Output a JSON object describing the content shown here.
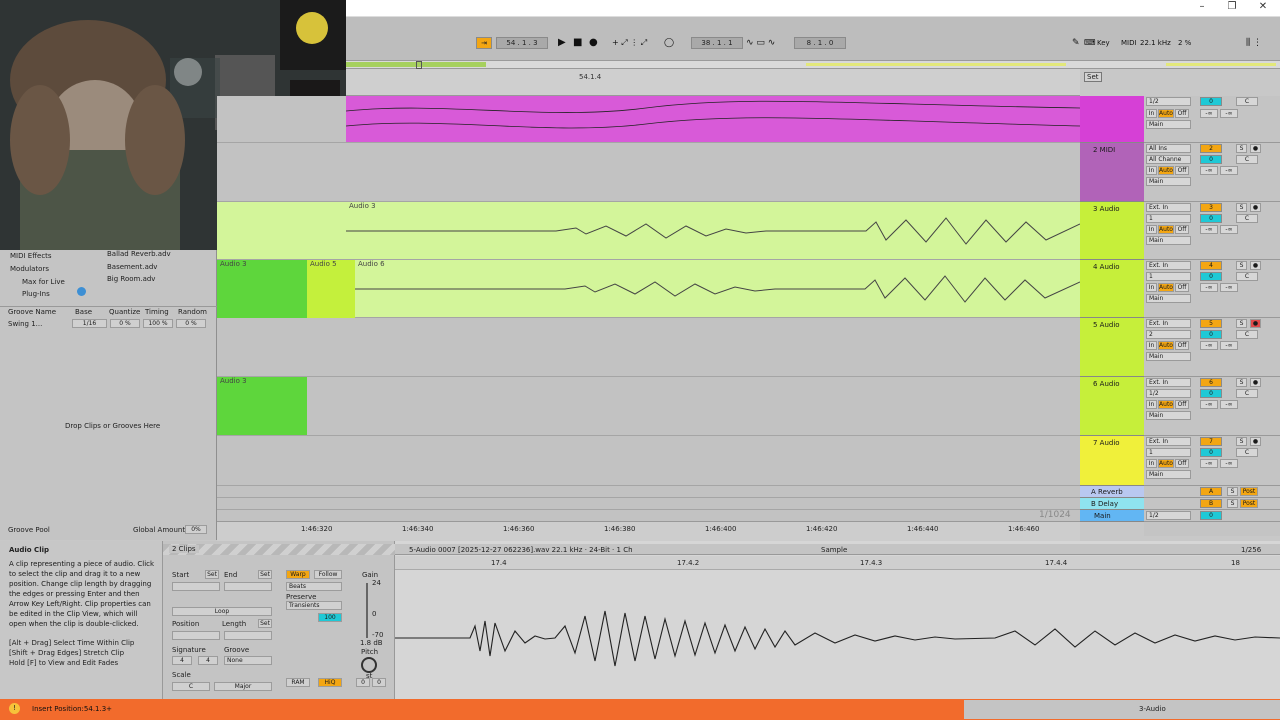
{
  "transport": {
    "tap": "⇥",
    "position": "54 .  1 .  3",
    "loop_start": "38 .  1 .  1",
    "loop_length": "8 .  1 .  0",
    "key": "Key",
    "midi": "MIDI",
    "sample_rate": "22.1 kHz",
    "cpu": "2 %"
  },
  "overview": {
    "marker": "54.1.4"
  },
  "arrangement": {
    "set_label": "Set",
    "pages": "1/1024",
    "drop_clips": "Drop Clips or Grooves Here",
    "clips": [
      {
        "name": "Audio 3"
      },
      {
        "name": "Audio 3"
      },
      {
        "name": "Audio 5"
      },
      {
        "name": "Audio 6"
      },
      {
        "name": "Audio 3"
      }
    ]
  },
  "timeline": [
    "1:46:320",
    "1:46:340",
    "1:46:360",
    "1:46:380",
    "1:46:400",
    "1:46:420",
    "1:46:440",
    "1:46:460"
  ],
  "browser": {
    "categories": [
      "MIDI Effects",
      "Modulators",
      "Max for Live",
      "Plug-Ins"
    ],
    "files": [
      "Ballad Reverb.adv",
      "Basement.adv",
      "Big Room.adv"
    ],
    "groove_headers": [
      "Groove Name",
      "Base",
      "Quantize",
      "Timing",
      "Random"
    ],
    "groove_row": {
      "name": "Swing 1...",
      "base": "1/16",
      "quantize": "0 %",
      "timing": "100 %",
      "random": "0 %"
    },
    "groove_pool": "Groove Pool",
    "global_amount_label": "Global Amount:",
    "global_amount": "0%"
  },
  "tracks": [
    {
      "name": "",
      "input": "1/2",
      "num": "",
      "vol": "0",
      "pan": "C",
      "out": "Main",
      "color": "#d640d6"
    },
    {
      "name": "2 MIDI",
      "input": "All Ins",
      "channel": "All Channe",
      "num": "2",
      "vol": "0",
      "pan": "C",
      "out": "Main",
      "color": "#b163b8"
    },
    {
      "name": "3 Audio",
      "input": "Ext. In",
      "channel": "1",
      "num": "3",
      "vol": "0",
      "pan": "C",
      "out": "Main",
      "color": "#c6ef3a"
    },
    {
      "name": "4 Audio",
      "input": "Ext. In",
      "channel": "1",
      "num": "4",
      "vol": "0",
      "pan": "C",
      "out": "Main",
      "color": "#c6ef3a"
    },
    {
      "name": "5 Audio",
      "input": "Ext. In",
      "channel": "2",
      "num": "5",
      "vol": "0",
      "pan": "C",
      "out": "Main",
      "color": "#c6ef3a"
    },
    {
      "name": "6 Audio",
      "input": "Ext. In",
      "channel": "1/2",
      "num": "6",
      "vol": "0",
      "pan": "C",
      "out": "Main",
      "color": "#c6ef3a"
    },
    {
      "name": "7 Audio",
      "input": "Ext. In",
      "channel": "1",
      "num": "7",
      "vol": "0",
      "pan": "C",
      "out": "Main",
      "color": "#f0f03a"
    }
  ],
  "returns": [
    {
      "name": "A Reverb",
      "num": "A",
      "post": "Post"
    },
    {
      "name": "B Delay",
      "num": "B",
      "post": "Post"
    }
  ],
  "master": {
    "name": "Main",
    "channel": "1/2",
    "vol": "0"
  },
  "mixer_labels": {
    "in": "In",
    "auto": "Auto",
    "off": "Off",
    "inf": "-∞",
    "s": "S"
  },
  "info": {
    "title": "Audio Clip",
    "body": "A clip representing a piece of audio. Click to select the clip and drag it to a new position. Change clip length by dragging the edges or pressing Enter and then Arrow Key Left/Right. Clip properties can be edited in the Clip View, which will open when the clip is double-clicked.",
    "hints": [
      "[Alt + Drag] Select Time Within Clip",
      "[Shift + Drag Edges] Stretch Clip",
      "Hold [F] to View and Edit Fades"
    ]
  },
  "clipview": {
    "title": "2 Clips",
    "start": "Start",
    "end": "End",
    "set": "Set",
    "loop": "Loop",
    "position": "Position",
    "length": "Length",
    "signature": "Signature",
    "sig_num": "4",
    "sig_den": "4",
    "groove": "Groove",
    "groove_val": "None",
    "scale": "Scale",
    "scale_root": "C",
    "scale_mode": "Major",
    "warp": "Warp",
    "follow": "Follow",
    "beats": "Beats",
    "preserve": "Preserve",
    "transients": "Transients",
    "amount": "100",
    "gain": "Gain",
    "gain_top": "24",
    "gain_mid": "0",
    "gain_bot": "-70",
    "gain_val": "1.8 dB",
    "pitch": "Pitch",
    "st": "st",
    "pitch_a": "0",
    "pitch_b": "0",
    "ram": "RAM",
    "hiq": "HiQ"
  },
  "sample": {
    "file": "5-Audio 0007 [2025-12-27 062236].wav  22.1 kHz · 24-Bit · 1 Ch",
    "tab": "Sample",
    "page": "1/256",
    "markers": [
      "17.4",
      "17.4.2",
      "17.4.3",
      "17.4.4",
      "18"
    ]
  },
  "status": {
    "text": "Insert Position:54.1.3+",
    "track": "3-Audio"
  }
}
